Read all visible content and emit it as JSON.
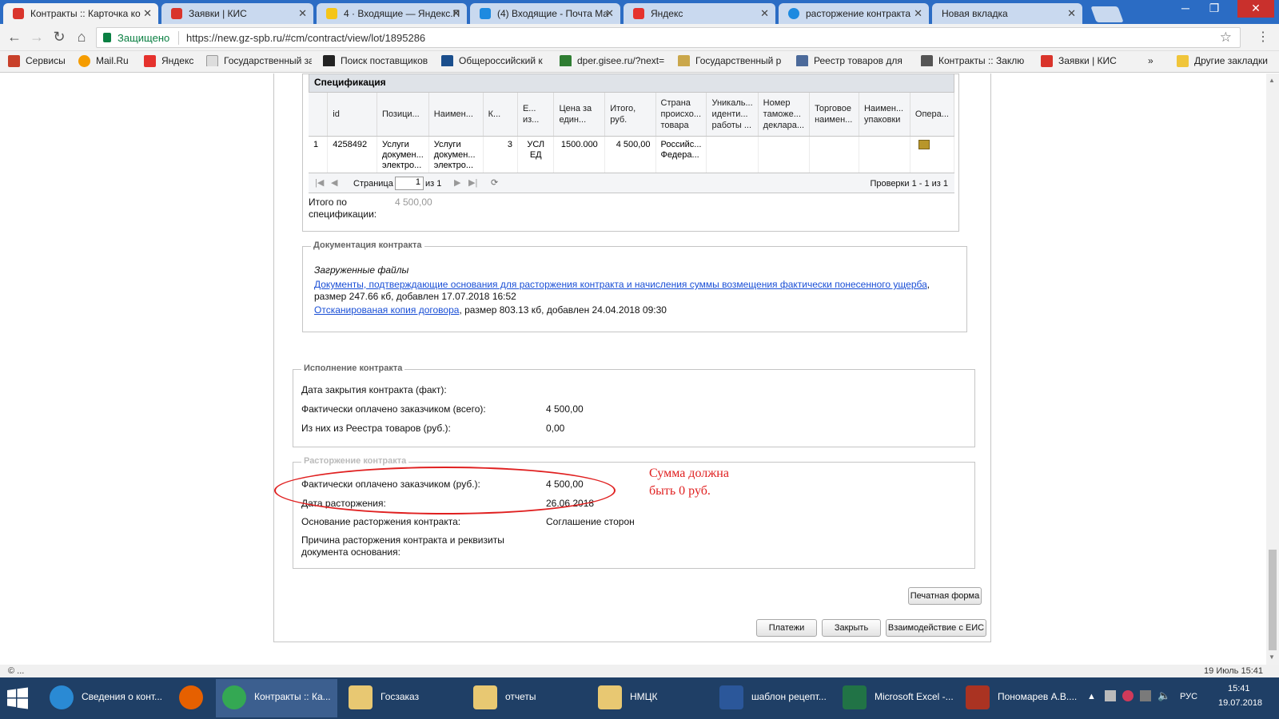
{
  "browser": {
    "tabs": [
      {
        "title": "Контракты :: Карточка ко",
        "icon_color": "#d9342b",
        "active": true
      },
      {
        "title": "Заявки | КИС",
        "icon_color": "#d9342b",
        "active": false
      },
      {
        "title": "4 · Входящие — Яндекс.П",
        "icon_color": "#f5c518",
        "active": false
      },
      {
        "title": "(4) Входящие - Почта Ма",
        "icon_color": "#1d8ae0",
        "active": false
      },
      {
        "title": "Яндекс",
        "icon_color": "#e5322d",
        "active": false
      },
      {
        "title": "расторжение контракта",
        "icon_color": "#1d8ae0",
        "active": false
      },
      {
        "title": "Новая вкладка",
        "icon_color": "",
        "active": false
      }
    ],
    "secure_label": "Защищено",
    "url": "https://new.gz-spb.ru/#cm/contract/view/lot/1895286",
    "bookmarks": [
      {
        "label": "Сервисы",
        "icon_color": "#c8402a"
      },
      {
        "label": "Mail.Ru",
        "icon_color": "#f59c00"
      },
      {
        "label": "Яндекс",
        "icon_color": "#e5322d"
      },
      {
        "label": "Государственный за",
        "icon_color": "#999999"
      },
      {
        "label": "Поиск поставщиков",
        "icon_color": "#222222"
      },
      {
        "label": "Общероссийский к",
        "icon_color": "#1a4e8c"
      },
      {
        "label": "dper.gisee.ru/?next=",
        "icon_color": "#2f7d32"
      },
      {
        "label": "Государственный р",
        "icon_color": "#caa74b"
      },
      {
        "label": "Реестр товаров для",
        "icon_color": "#4c6a9a"
      },
      {
        "label": "Контракты :: Заклю",
        "icon_color": "#555555"
      },
      {
        "label": "Заявки | КИС",
        "icon_color": "#d9342b"
      }
    ],
    "bookmarks_more": "»",
    "other_bookmarks": "Другие закладки"
  },
  "spec": {
    "title": "Спецификация",
    "columns": [
      "",
      "id",
      "Позици...",
      "Наимен...",
      "К...",
      "Е... из...",
      "Цена за един...",
      "Итого, руб.",
      "Страна происхо... товара",
      "Уникаль... иденти... работы ...",
      "Номер таможе... деклара...",
      "Торговое наимен...",
      "Наимен... упаковки",
      "Опера..."
    ],
    "rows": [
      [
        "1",
        "4258492",
        "Услуги докумен... электро...",
        "Услуги докумен... электро...",
        "3",
        "УСЛ ЕД",
        "1500.000",
        "4 500,00",
        "Российс... Федера...",
        "",
        "",
        "",
        "",
        ""
      ]
    ],
    "pager": {
      "page_label": "Страница",
      "page_value": "1",
      "of_label": "из 1",
      "summary": "Проверки 1 - 1 из 1"
    },
    "total_label": "Итого по спецификации:",
    "total_value": "4 500,00"
  },
  "docs": {
    "legend": "Документация контракта",
    "uploaded_label": "Загруженные файлы",
    "files": [
      {
        "link": "Документы, подтверждающие основания для расторжения контракта и начисления суммы возмещения фактически понесенного ущерба",
        "meta": ", размер 247.66 кб, добавлен 17.07.2018 16:52"
      },
      {
        "link": "Отсканированая копия договора",
        "meta": ", размер 803.13 кб, добавлен 24.04.2018 09:30"
      }
    ]
  },
  "execution": {
    "legend": "Исполнение контракта",
    "fields": [
      {
        "label": "Дата закрытия контракта (факт):",
        "value": ""
      },
      {
        "label": "Фактически оплачено заказчиком (всего):",
        "value": "4 500,00"
      },
      {
        "label": "Из них из Реестра товаров (руб.):",
        "value": "0,00"
      }
    ]
  },
  "termination": {
    "legend": "Расторжение контракта",
    "fields": [
      {
        "label": "Фактически оплачено заказчиком (руб.):",
        "value": "4 500,00"
      },
      {
        "label": "Дата расторжения:",
        "value": "26.06.2018"
      },
      {
        "label": "Основание расторжения контракта:",
        "value": "Соглашение сторон"
      },
      {
        "label": "Причина расторжения контракта и реквизиты документа основания:",
        "value": ""
      }
    ]
  },
  "annotation": {
    "line1": "Сумма должна",
    "line2": "быть 0 руб."
  },
  "buttons": {
    "print": "Печатная форма",
    "payments": "Платежи",
    "close": "Закрыть",
    "eis": "Взаимодействие с ЕИС"
  },
  "statusbar": {
    "left": "© ...",
    "right": "19 Июль 15:41"
  },
  "taskbar": {
    "items": [
      {
        "label": "Сведения о конт...",
        "icon_color": "#2a8ad4"
      },
      {
        "label": "",
        "icon_color": "#e66000"
      },
      {
        "label": "Контракты :: Ка...",
        "icon_color": "#34a853",
        "active": true
      },
      {
        "label": "Госзаказ",
        "icon_color": "#e8c872"
      },
      {
        "label": "отчеты",
        "icon_color": "#e8c872"
      },
      {
        "label": "НМЦК",
        "icon_color": "#e8c872"
      },
      {
        "label": "шаблон рецепт...",
        "icon_color": "#2b579a"
      },
      {
        "label": "Microsoft Excel -...",
        "icon_color": "#217346"
      },
      {
        "label": "Пономарев А.В....",
        "icon_color": "#aa3322"
      }
    ],
    "lang": "РУС",
    "time": "15:41",
    "date": "19.07.2018"
  }
}
